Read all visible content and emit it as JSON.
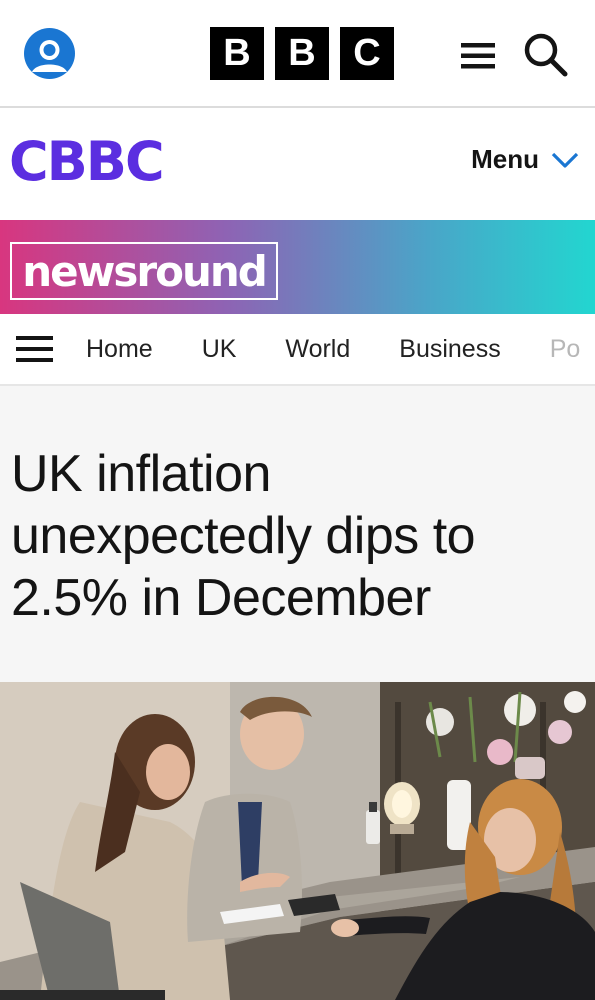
{
  "bbc_header": {
    "logo_letters": [
      "B",
      "B",
      "C"
    ],
    "icons": [
      "account-icon",
      "menu-icon",
      "search-icon"
    ],
    "account_color": "#1a76d2"
  },
  "cbbc_header": {
    "logo": "CBBC",
    "logo_color": "#5b2ee0",
    "menu_label": "Menu",
    "chevron_color": "#1a76d2"
  },
  "newsround": {
    "logo": "newsround"
  },
  "section_nav": {
    "items": [
      "Home",
      "UK",
      "World",
      "Business",
      "Po"
    ]
  },
  "article": {
    "headline": "UK inflation unexpectedly dips to 2.5% in December"
  }
}
